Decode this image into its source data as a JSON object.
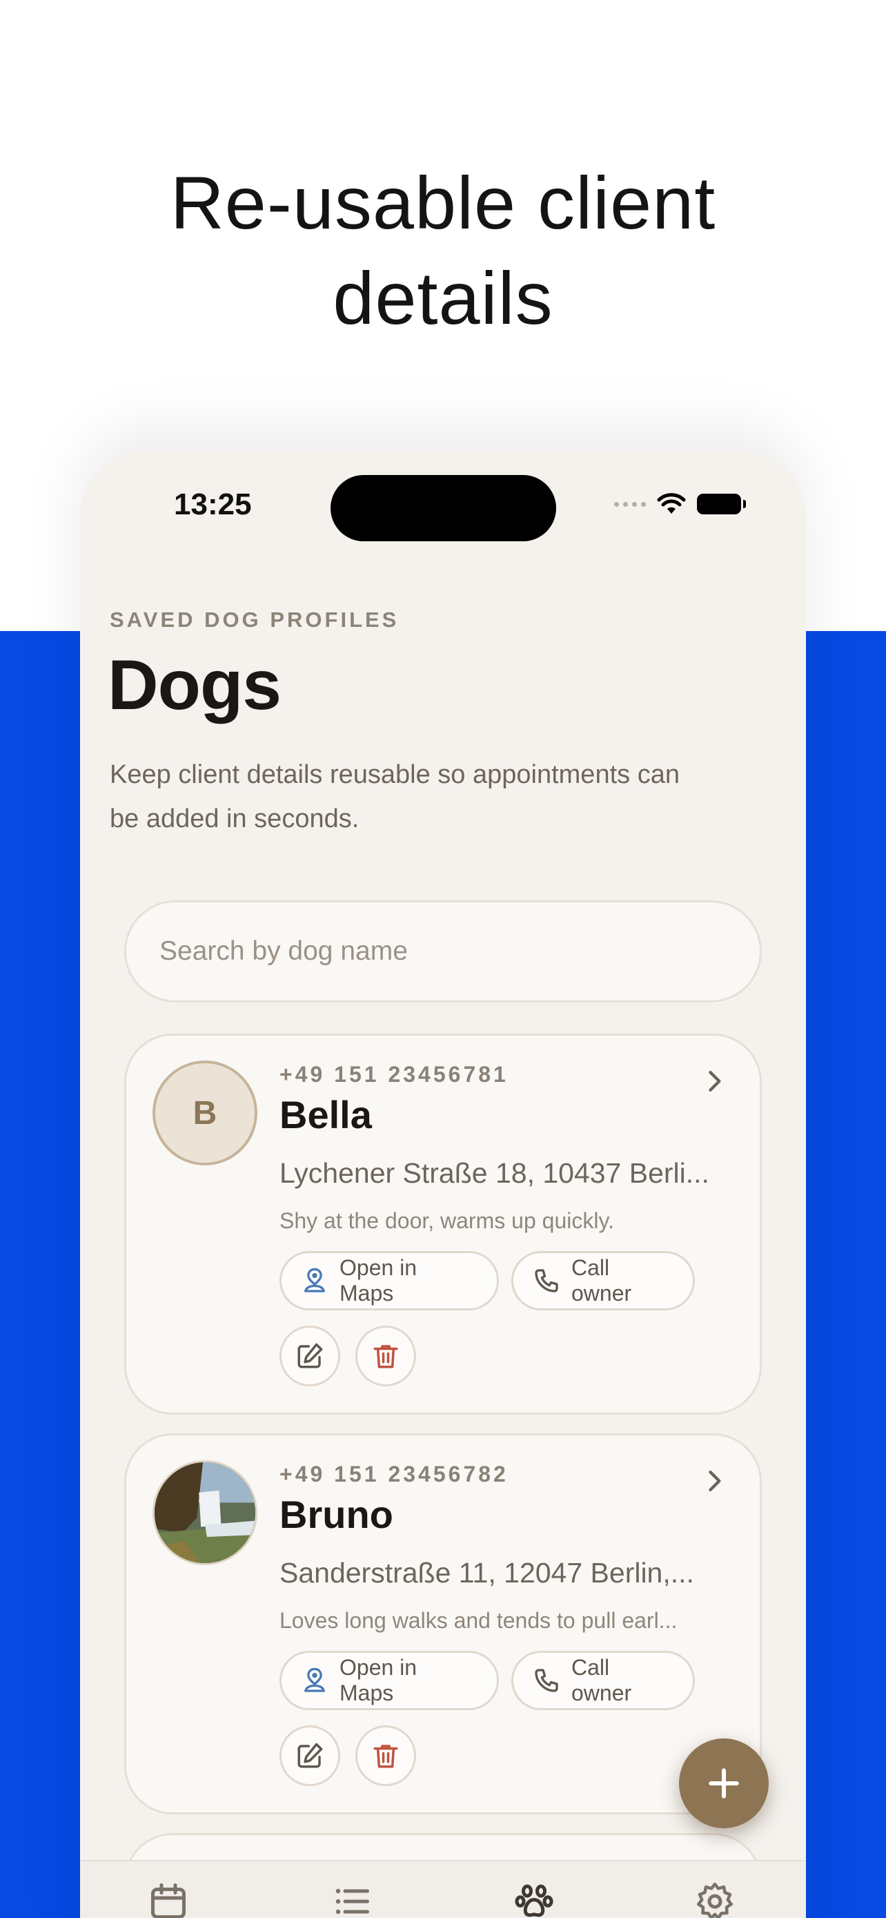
{
  "headline": "Re-usable client\ndetails",
  "status_bar": {
    "time": "13:25"
  },
  "page": {
    "eyebrow": "SAVED DOG PROFILES",
    "title": "Dogs",
    "subtitle": "Keep client details reusable so appointments can be added in seconds."
  },
  "search": {
    "placeholder": "Search by dog name",
    "value": ""
  },
  "dogs": [
    {
      "initial": "B",
      "phone": "+49 151 23456781",
      "name": "Bella",
      "address": "Lychener Straße 18, 10437 Berli...",
      "note": "Shy at the door, warms up quickly.",
      "maps_label": "Open in Maps",
      "call_label": "Call owner"
    },
    {
      "phone": "+49 151 23456782",
      "name": "Bruno",
      "address": "Sanderstraße 11, 12047 Berlin,...",
      "note": "Loves long walks and tends to pull earl...",
      "maps_label": "Open in Maps",
      "call_label": "Call owner"
    }
  ],
  "tabs": [
    {
      "icon": "calendar-icon"
    },
    {
      "icon": "list-icon"
    },
    {
      "icon": "paw-icon"
    },
    {
      "icon": "gear-icon"
    }
  ],
  "colors": {
    "background_blue": "#0649e3",
    "phone_surface": "#f5f2ee",
    "accent_brown": "#8d7452",
    "delete_red": "#c0533f",
    "maps_blue": "#4a78b5"
  }
}
